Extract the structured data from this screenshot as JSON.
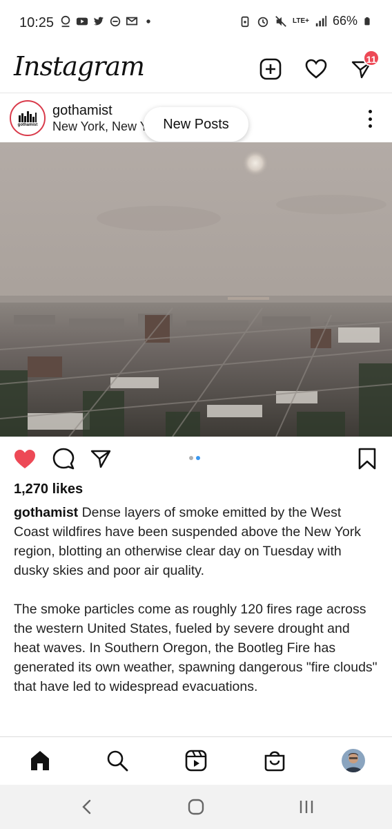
{
  "status_bar": {
    "time": "10:25",
    "network": "LTE+",
    "battery": "66%",
    "icons": [
      "notification-icon",
      "youtube-icon",
      "twitter-icon",
      "minus-circle-icon",
      "message-icon",
      "dot-icon",
      "battery-saver-icon",
      "alarm-icon",
      "mute-icon",
      "signal-icon",
      "battery-icon"
    ]
  },
  "app": {
    "logo_text": "Instagram",
    "notification_count": "11"
  },
  "post": {
    "username": "gothamist",
    "location": "New York, New York",
    "avatar_word": "gothamist",
    "new_posts_label": "New Posts",
    "likes": "1,270 likes",
    "caption_user": "gothamist",
    "caption_p1": "Dense layers of smoke emitted by the West Coast wildfires have been suspended above the New York region, blotting an otherwise clear day on Tuesday with dusky skies and poor air quality.",
    "caption_p2": "The smoke particles come as roughly 120 fires rage across the western United States, fueled by severe drought and heat waves. In Southern Oregon, the Bootleg Fire has generated its own weather, spawning dangerous \"fire clouds\" that have led to widespread evacuations.",
    "carousel": {
      "count": 2,
      "active_index": 1
    },
    "liked": true
  },
  "colors": {
    "like_red": "#ed4956",
    "carousel_blue": "#3897f0",
    "badge_red": "#ed4956"
  },
  "bottom_nav": [
    "home-icon",
    "search-icon",
    "reels-icon",
    "shop-icon",
    "profile-avatar"
  ],
  "system_nav": [
    "back-icon",
    "home-circle-icon",
    "recents-icon"
  ]
}
